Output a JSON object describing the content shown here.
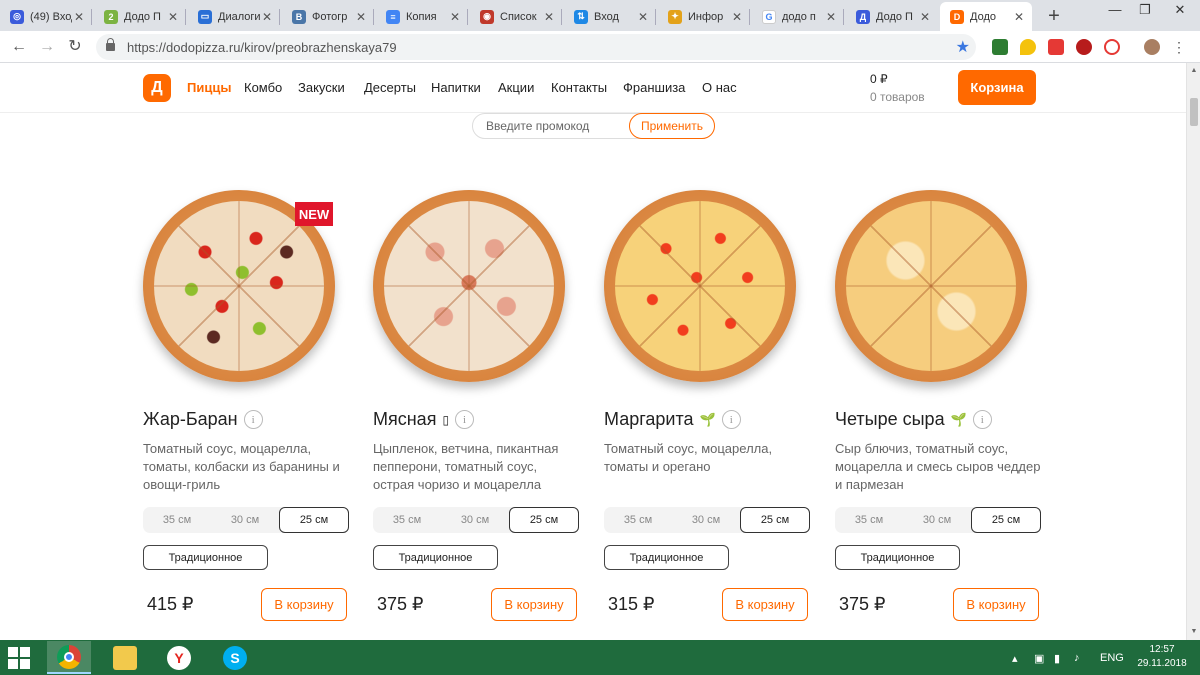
{
  "browser": {
    "tabs": [
      {
        "title": "(49) Вход",
        "color": "#3b5bdb",
        "glyph": "◎"
      },
      {
        "title": "Додо П",
        "color": "#7cb342",
        "glyph": "2"
      },
      {
        "title": "Диалоги",
        "color": "#2a6fd6",
        "glyph": "▭"
      },
      {
        "title": "Фотогр",
        "color": "#4a76a8",
        "glyph": "В"
      },
      {
        "title": "Копия",
        "color": "#4285f4",
        "glyph": "≡"
      },
      {
        "title": "Список",
        "color": "#c0392b",
        "glyph": "◉"
      },
      {
        "title": "Вход",
        "color": "#1e88e5",
        "glyph": "⇅"
      },
      {
        "title": "Инфор",
        "color": "#e3a21a",
        "glyph": "✦"
      },
      {
        "title": "додо п",
        "color": "#ffffff",
        "glyph": "G"
      },
      {
        "title": "Додо П",
        "color": "#3b5bdb",
        "glyph": "Д"
      },
      {
        "title": "Додо",
        "color": "#ff6900",
        "glyph": "D"
      }
    ],
    "address": "https://dodopizza.ru/kirov/preobrazhenskaya79"
  },
  "header": {
    "logo_letter": "Д",
    "nav": [
      "Пиццы",
      "Комбо",
      "Закуски",
      "Десерты",
      "Напитки",
      "Акции",
      "Контакты",
      "Франшиза",
      "О нас"
    ],
    "cart_sum": "0 ₽",
    "cart_count": "0 товаров",
    "cart_button": "Корзина"
  },
  "promo": {
    "placeholder": "Введите промокод",
    "apply": "Применить"
  },
  "sizes": [
    "35 см",
    "30 см",
    "25 см"
  ],
  "dough": "Традиционное",
  "buy_label": "В корзину",
  "new_badge": "NEW",
  "products": [
    {
      "name": "Жар-Баран",
      "desc": "Томатный соус, моцарелла, томаты, колбаски из баранины и овощи-гриль",
      "price": "415 ₽",
      "marker": ""
    },
    {
      "name": "Мясная",
      "desc": "Цыпленок, ветчина, пикантная пепперони, томатный соус, острая чоризо и моцарелла",
      "price": "375 ₽",
      "marker": "▯"
    },
    {
      "name": "Маргарита",
      "desc": "Томатный соус, моцарелла, томаты и орегано",
      "price": "315 ₽",
      "marker": "🌱"
    },
    {
      "name": "Четыре сыра",
      "desc": "Сыр блючиз, томатный соус, моцарелла и смесь сыров чеддер и пармезан",
      "price": "375 ₽",
      "marker": "🌱"
    }
  ],
  "taskbar": {
    "lang": "ENG",
    "time": "12:57",
    "date": "29.11.2018"
  },
  "colors": {
    "brand": "#ff6900",
    "new_badge": "#e0162b",
    "taskbar": "#1f6b3d"
  }
}
